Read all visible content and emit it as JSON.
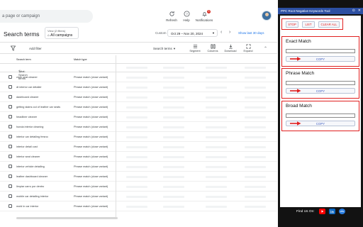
{
  "topbar": {
    "search_placeholder": "a page or campaign",
    "refresh_label": "Refresh",
    "help_label": "Help",
    "notifications_label": "Notifications",
    "notifications_count": "3"
  },
  "header": {
    "page_title": "Search terms",
    "view_line1": "View (2 filters)",
    "view_line2": "All campaigns",
    "custom_label": "Custom",
    "date_range": "Oct 29 – Nov 20, 2024",
    "show_last": "Show last 30 days"
  },
  "toolbar": {
    "add_filter": "Add filter",
    "search_terms_dropdown": "Search terms",
    "segment": "Segment",
    "columns": "Columns",
    "download": "Download",
    "expand": "Expand"
  },
  "table": {
    "col_search_term": "Search term",
    "col_match_type": "Match type",
    "total_label": "Total: Search terms",
    "rows": [
      {
        "term": "cloth seat cleaner",
        "match": "Phrase match (close variant)"
      },
      {
        "term": "dt interior car detailer",
        "match": "Phrase match (close variant)"
      },
      {
        "term": "dashboard cleaner",
        "match": "Phrase match (close variant)"
      },
      {
        "term": "getting stains out of leather car seats",
        "match": "Phrase match (close variant)"
      },
      {
        "term": "headliner cleaner",
        "match": "Phrase match (close variant)"
      },
      {
        "term": "honda interior cleaning",
        "match": "Phrase match (close variant)"
      },
      {
        "term": "interior car detailing fresno",
        "match": "Phrase match (close variant)"
      },
      {
        "term": "interior detail cost",
        "match": "Phrase match (close variant)"
      },
      {
        "term": "interior seat cleaner",
        "match": "Phrase match (close variant)"
      },
      {
        "term": "interior vehicle detailing",
        "match": "Phrase match (close variant)"
      },
      {
        "term": "leather dashboard cleaner",
        "match": "Phrase match (close variant)"
      },
      {
        "term": "limpiar carro por dentro",
        "match": "Phrase match (close variant)"
      },
      {
        "term": "mobile car detailing interior",
        "match": "Phrase match (close variant)"
      },
      {
        "term": "mold in car interior",
        "match": "Phrase match (close variant)"
      }
    ]
  },
  "extension": {
    "title": "PPC Root Negative Keywords Tool",
    "stop_label": "STOP",
    "list_label": "LIST",
    "clear_all_label": "CLEAR ALL",
    "exact_title": "Exact Match",
    "phrase_title": "Phrase Match",
    "broad_title": "Broad Match",
    "copy_label": "COPY",
    "footer_text": "Find Us On:",
    "social_icons": [
      "youtube-icon",
      "linkedin-icon",
      "blogger-icon"
    ],
    "colors": {
      "title_bar": "#2c4fa2",
      "accent_red": "#e02020",
      "copy_text": "#3b5bbf",
      "youtube": "#ff0000",
      "linkedin": "#0a66c2",
      "third": "#2a7de1"
    }
  }
}
